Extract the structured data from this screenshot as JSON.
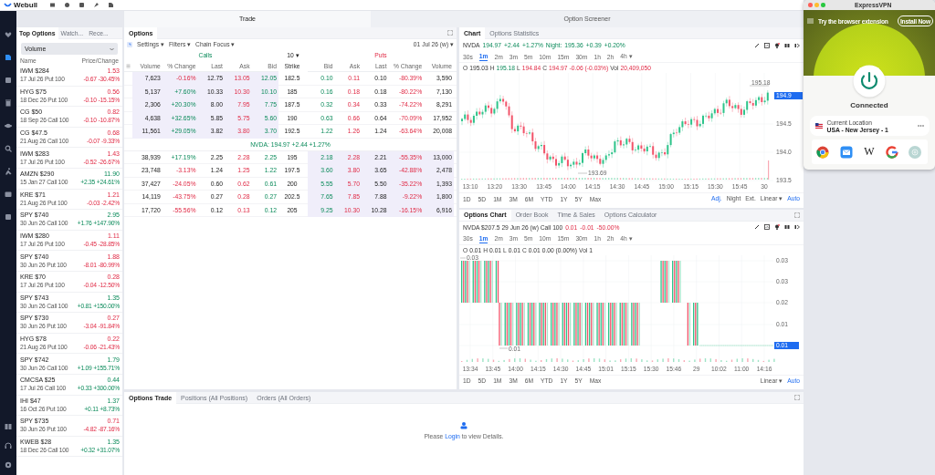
{
  "app": {
    "name": "Webull"
  },
  "nav": [
    {
      "selected": false
    },
    {
      "selected": true
    },
    {
      "selected": false
    },
    {
      "selected": false
    },
    {
      "selected": false
    },
    {
      "selected": false
    },
    {
      "selected": false
    },
    {
      "selected": false
    },
    {
      "selected": false
    }
  ],
  "main_tabs": [
    {
      "label": "Trade",
      "selected": true
    },
    {
      "label": "Option Screener",
      "selected": false
    }
  ],
  "top_options": {
    "tabs": [
      {
        "label": "Top Options",
        "selected": true
      },
      {
        "label": "Watch...",
        "selected": false
      },
      {
        "label": "Rece...",
        "selected": false
      }
    ],
    "sort": "Volume",
    "columns": [
      "Name",
      "Price/Change"
    ],
    "items": [
      {
        "name": "IWM $284",
        "detail": "17 Jul 26 Put 100",
        "price": "1.53",
        "change": "-0.67 -30.45%",
        "positive": false
      },
      {
        "name": "HYG $75",
        "detail": "18 Dec 26 Put 100",
        "price": "0.56",
        "change": "-0.10 -15.15%",
        "positive": false
      },
      {
        "name": "CG $50",
        "detail": "18 Sep 26 Call 100",
        "price": "0.82",
        "change": "-0.10 -10.87%",
        "positive": false
      },
      {
        "name": "CG $47.5",
        "detail": "21 Aug 26 Call 100",
        "price": "0.68",
        "change": "-0.07 -9.33%",
        "positive": false
      },
      {
        "name": "IWM $283",
        "detail": "17 Jul 26 Put 100",
        "price": "1.43",
        "change": "-0.52 -26.67%",
        "positive": false
      },
      {
        "name": "AMZN $290",
        "detail": "15 Jan 27 Call 100",
        "price": "11.90",
        "change": "+2.35 +24.61%",
        "positive": true
      },
      {
        "name": "KRE $71",
        "detail": "21 Aug 26 Put 100",
        "price": "1.21",
        "change": "-0.03 -2.42%",
        "positive": false
      },
      {
        "name": "SPY $740",
        "detail": "30 Jun 26 Call 100",
        "price": "2.95",
        "change": "+1.76 +147.90%",
        "positive": true
      },
      {
        "name": "IWM $280",
        "detail": "17 Jul 26 Put 100",
        "price": "1.11",
        "change": "-0.45 -28.85%",
        "positive": false
      },
      {
        "name": "SPY $740",
        "detail": "30 Jun 26 Put 100",
        "price": "1.88",
        "change": "-8.01 -80.99%",
        "positive": false
      },
      {
        "name": "KRE $70",
        "detail": "17 Jul 26 Put 100",
        "price": "0.28",
        "change": "-0.04 -12.50%",
        "positive": false
      },
      {
        "name": "SPY $743",
        "detail": "30 Jun 26 Call 100",
        "price": "1.35",
        "change": "+0.81 +150.00%",
        "positive": true
      },
      {
        "name": "SPY $730",
        "detail": "30 Jun 26 Put 100",
        "price": "0.27",
        "change": "-3.04 -91.84%",
        "positive": false
      },
      {
        "name": "HYG $78",
        "detail": "21 Aug 26 Put 100",
        "price": "0.22",
        "change": "-0.06 -21.43%",
        "positive": false
      },
      {
        "name": "SPY $742",
        "detail": "30 Jun 26 Call 100",
        "price": "1.79",
        "change": "+1.09 +155.71%",
        "positive": true
      },
      {
        "name": "CMCSA $25",
        "detail": "17 Jul 26 Call 100",
        "price": "0.44",
        "change": "+0.33 +300.00%",
        "positive": true
      },
      {
        "name": "IHI $47",
        "detail": "16 Oct 26 Put 100",
        "price": "1.37",
        "change": "+0.11 +8.73%",
        "positive": true
      },
      {
        "name": "SPY $735",
        "detail": "30 Jun 26 Put 100",
        "price": "0.71",
        "change": "-4.82 -87.16%",
        "positive": false
      },
      {
        "name": "KWEB $28",
        "detail": "18 Dec 26 Call 100",
        "price": "1.35",
        "change": "+0.32 +31.07%",
        "positive": true
      }
    ]
  },
  "options": {
    "title": "Options",
    "menus": [
      "Settings ▾",
      "Filters ▾",
      "Chain Focus ▾"
    ],
    "expiry": "01 Jul 26 (w) ▾",
    "calls_label": "Calls",
    "strike_count": "10 ▾",
    "puts_label": "Puts",
    "call_columns": [
      "Volume",
      "% Change",
      "Last",
      "Ask",
      "Bid"
    ],
    "strike_column": "Strike",
    "put_columns": [
      "Bid",
      "Ask",
      "Last",
      "% Change",
      "Volume"
    ],
    "underlying": "NVDA:  194.97 +2.44 +1.27%",
    "rows": [
      {
        "calls_itm": true,
        "puts_itm": false,
        "strike": "182.5",
        "calls": [
          "7,623",
          "-0.16%",
          "12.75",
          "13.05",
          "12.05"
        ],
        "call_positive": false,
        "puts": [
          "0.10",
          "0.11",
          "0.10",
          "-80.39%",
          "3,590"
        ],
        "put_positive": false
      },
      {
        "calls_itm": true,
        "puts_itm": false,
        "strike": "185",
        "calls": [
          "5,137",
          "+7.60%",
          "10.33",
          "10.30",
          "10.10"
        ],
        "call_positive": true,
        "puts": [
          "0.16",
          "0.18",
          "0.18",
          "-80.22%",
          "7,130"
        ],
        "put_positive": false
      },
      {
        "calls_itm": true,
        "puts_itm": false,
        "strike": "187.5",
        "calls": [
          "2,306",
          "+20.30%",
          "8.00",
          "7.95",
          "7.75"
        ],
        "call_positive": true,
        "puts": [
          "0.32",
          "0.34",
          "0.33",
          "-74.22%",
          "8,291"
        ],
        "put_positive": false
      },
      {
        "calls_itm": true,
        "puts_itm": false,
        "strike": "190",
        "calls": [
          "4,638",
          "+32.65%",
          "5.85",
          "5.75",
          "5.60"
        ],
        "call_positive": true,
        "puts": [
          "0.63",
          "0.66",
          "0.64",
          "-70.09%",
          "17,952"
        ],
        "put_positive": false
      },
      {
        "calls_itm": true,
        "puts_itm": false,
        "strike": "192.5",
        "calls": [
          "11,561",
          "+29.05%",
          "3.82",
          "3.80",
          "3.70"
        ],
        "call_positive": true,
        "puts": [
          "1.22",
          "1.26",
          "1.24",
          "-63.64%",
          "20,008"
        ],
        "put_positive": false
      },
      {
        "calls_itm": false,
        "puts_itm": true,
        "strike": "195",
        "calls": [
          "38,939",
          "+17.19%",
          "2.25",
          "2.28",
          "2.25"
        ],
        "call_positive": true,
        "puts": [
          "2.18",
          "2.28",
          "2.21",
          "-55.35%",
          "13,000"
        ],
        "put_positive": false
      },
      {
        "calls_itm": false,
        "puts_itm": true,
        "strike": "197.5",
        "calls": [
          "23,748",
          "-3.13%",
          "1.24",
          "1.25",
          "1.22"
        ],
        "call_positive": false,
        "puts": [
          "3.60",
          "3.80",
          "3.65",
          "-42.88%",
          "2,478"
        ],
        "put_positive": false
      },
      {
        "calls_itm": false,
        "puts_itm": true,
        "strike": "200",
        "calls": [
          "37,427",
          "-24.05%",
          "0.60",
          "0.62",
          "0.61"
        ],
        "call_positive": false,
        "puts": [
          "5.55",
          "5.70",
          "5.50",
          "-35.22%",
          "1,393"
        ],
        "put_positive": false
      },
      {
        "calls_itm": false,
        "puts_itm": true,
        "strike": "202.5",
        "calls": [
          "14,119",
          "-43.75%",
          "0.27",
          "0.28",
          "0.27"
        ],
        "call_positive": false,
        "puts": [
          "7.65",
          "7.85",
          "7.88",
          "-9.22%",
          "1,800"
        ],
        "put_positive": false
      },
      {
        "calls_itm": false,
        "puts_itm": true,
        "strike": "205",
        "calls": [
          "17,720",
          "-55.56%",
          "0.12",
          "0.13",
          "0.12"
        ],
        "call_positive": false,
        "puts": [
          "9.25",
          "10.30",
          "10.28",
          "-16.15%",
          "6,916"
        ],
        "put_positive": false
      }
    ]
  },
  "chart": {
    "tabs": [
      {
        "label": "Chart",
        "selected": true
      },
      {
        "label": "Options Statistics",
        "selected": false
      }
    ],
    "quote": [
      {
        "text": "NVDA",
        "kind": "neutral"
      },
      {
        "text": "194.97",
        "kind": "up"
      },
      {
        "text": "+2.44",
        "kind": "up"
      },
      {
        "text": "+1.27%",
        "kind": "up"
      },
      {
        "text": "Night:",
        "kind": "up"
      },
      {
        "text": "195.36",
        "kind": "up"
      },
      {
        "text": "+0.39",
        "kind": "up"
      },
      {
        "text": "+0.20%",
        "kind": "up"
      }
    ],
    "intervals": [
      {
        "label": "30s",
        "selected": false
      },
      {
        "label": "1m",
        "selected": true
      },
      {
        "label": "2m",
        "selected": false
      },
      {
        "label": "3m",
        "selected": false
      },
      {
        "label": "5m",
        "selected": false
      },
      {
        "label": "10m",
        "selected": false
      },
      {
        "label": "15m",
        "selected": false
      },
      {
        "label": "30m",
        "selected": false
      },
      {
        "label": "1h",
        "selected": false
      },
      {
        "label": "2h",
        "selected": false
      },
      {
        "label": "4h ▾",
        "selected": false
      }
    ],
    "ohlc": [
      {
        "text": "O",
        "kind": "label"
      },
      {
        "text": "195.03",
        "kind": "neutral"
      },
      {
        "text": "H",
        "kind": "label"
      },
      {
        "text": "195.18",
        "kind": "up"
      },
      {
        "text": "L",
        "kind": "label"
      },
      {
        "text": "194.84",
        "kind": "down"
      },
      {
        "text": "C",
        "kind": "label"
      },
      {
        "text": "194.97",
        "kind": "down"
      },
      {
        "text": "-0.06 (-0.03%)",
        "kind": "down"
      },
      {
        "text": "Vol",
        "kind": "label"
      },
      {
        "text": "20,409,050",
        "kind": "down"
      }
    ],
    "price_labels": [
      "194.5",
      "194.0",
      "193.5"
    ],
    "last_price": "194.9",
    "high_marker": "195.18",
    "low_marker": "193.69",
    "time_labels": [
      "13:10",
      "13:20",
      "13:30",
      "13:45",
      "14:00",
      "14:15",
      "14:30",
      "14:45",
      "15:00",
      "15:15",
      "15:30",
      "15:45",
      "30"
    ],
    "ranges": [
      "1D",
      "5D",
      "1M",
      "3M",
      "6M",
      "YTD",
      "1Y",
      "5Y",
      "Max"
    ],
    "settings": [
      {
        "label": "Adj.",
        "selected": true
      },
      {
        "label": "Night",
        "selected": false
      },
      {
        "label": "Ext.",
        "selected": false
      },
      {
        "label": "Linear ▾",
        "selected": false
      },
      {
        "label": "Auto",
        "selected": true
      }
    ]
  },
  "options_chart": {
    "tabs": [
      {
        "label": "Options Chart",
        "selected": true
      },
      {
        "label": "Order Book",
        "selected": false
      },
      {
        "label": "Time & Sales",
        "selected": false
      },
      {
        "label": "Options Calculator",
        "selected": false
      }
    ],
    "quote": [
      {
        "text": "NVDA $207.5 29 Jun 26 (w) Call 100",
        "kind": "neutral"
      },
      {
        "text": "0.01",
        "kind": "down"
      },
      {
        "text": "-0.01",
        "kind": "down"
      },
      {
        "text": "-50.00%",
        "kind": "down"
      }
    ],
    "intervals": [
      {
        "label": "30s",
        "selected": false
      },
      {
        "label": "1m",
        "selected": true
      },
      {
        "label": "2m",
        "selected": false
      },
      {
        "label": "3m",
        "selected": false
      },
      {
        "label": "5m",
        "selected": false
      },
      {
        "label": "10m",
        "selected": false
      },
      {
        "label": "15m",
        "selected": false
      },
      {
        "label": "30m",
        "selected": false
      },
      {
        "label": "1h",
        "selected": false
      },
      {
        "label": "2h",
        "selected": false
      },
      {
        "label": "4h ▾",
        "selected": false
      }
    ],
    "ohlc": [
      {
        "text": "O",
        "kind": "label"
      },
      {
        "text": "0.01",
        "kind": "neutral"
      },
      {
        "text": "H",
        "kind": "label"
      },
      {
        "text": "0.01",
        "kind": "neutral"
      },
      {
        "text": "L",
        "kind": "label"
      },
      {
        "text": "0.01",
        "kind": "neutral"
      },
      {
        "text": "C",
        "kind": "label"
      },
      {
        "text": "0.01",
        "kind": "neutral"
      },
      {
        "text": "0.00 (0.00%)",
        "kind": "neutral"
      },
      {
        "text": "Vol",
        "kind": "label"
      },
      {
        "text": "1",
        "kind": "neutral"
      }
    ],
    "price_labels": [
      "0.03",
      "0.03",
      "0.02",
      "0.01"
    ],
    "last_price": "0.01",
    "high_marker": "0.03",
    "low_marker": "0.01",
    "time_labels": [
      "13:34",
      "13:45",
      "14:00",
      "14:15",
      "14:30",
      "14:45",
      "15:01",
      "15:15",
      "15:30",
      "15:46",
      "29",
      "10:02",
      "11:00",
      "14:16"
    ],
    "ranges": [
      "1D",
      "5D",
      "1M",
      "3M",
      "6M",
      "YTD",
      "1Y",
      "5Y",
      "Max"
    ],
    "settings": [
      {
        "label": "Linear ▾",
        "selected": false
      },
      {
        "label": "Auto",
        "selected": true
      }
    ]
  },
  "trade_panel": {
    "tabs": [
      {
        "label": "Options Trade",
        "selected": true
      },
      {
        "label": "Positions (All Positions)",
        "selected": false
      },
      {
        "label": "Orders (All Orders)",
        "selected": false
      }
    ],
    "message_start": "Please ",
    "login_link": "Login",
    "message_end": " to view Details."
  },
  "vpn": {
    "title": "ExpressVPN",
    "promo": "Try the browser extension",
    "install_button": "Install Now",
    "status": "Connected",
    "location_label": "Current Location",
    "location": "USA - New Jersey - 1",
    "shortcut_letter": "W"
  }
}
